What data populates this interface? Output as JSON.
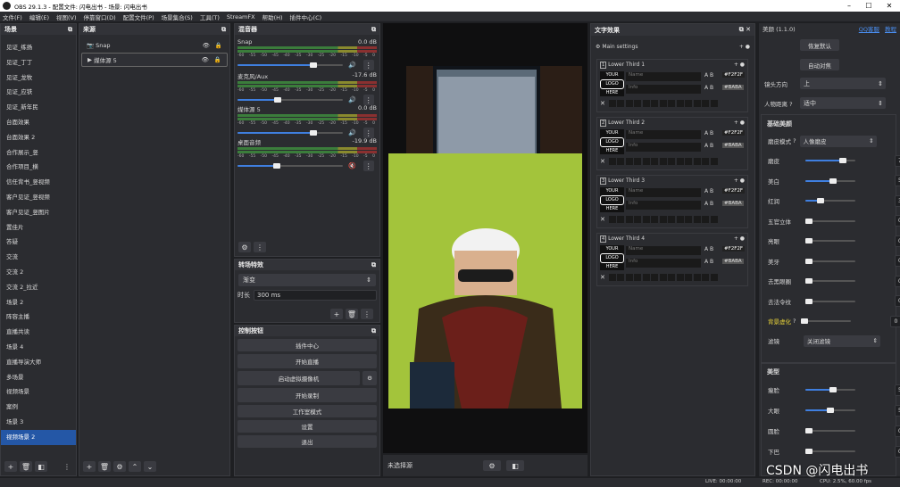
{
  "window": {
    "title": "OBS 29.1.3 - 配置文件: 闪电出书 - 场景: 闪电出书",
    "minimize": "–",
    "maximize": "☐",
    "close": "✕"
  },
  "menu": [
    "文件(F)",
    "编辑(E)",
    "视图(V)",
    "停靠窗口(D)",
    "配置文件(P)",
    "场景集合(S)",
    "工具(T)",
    "StreamFX",
    "帮助(H)",
    "插件中心(C)"
  ],
  "scenes": {
    "title": "场景",
    "items": [
      "见证_练扬",
      "见证_丁丁",
      "见证_龙牧",
      "见证_应铁",
      "见证_新年民",
      "台面效果",
      "台面效果 2",
      "合作展示_竖",
      "合作项目_横",
      "信任背书_竖视频",
      "客户见证_竖视频",
      "客户见证_竖图片",
      "置佳片",
      "答疑",
      "交流",
      "交流 2",
      "交流 2_拉近",
      "场景 2",
      "阵容主播",
      "直播共读",
      "场景 4",
      "直播导演大师",
      "多场景",
      "视频场景",
      "案例",
      "场景 3",
      "视频场景 2"
    ],
    "selected": 26
  },
  "sources": {
    "title": "来源",
    "items": [
      "Snap",
      "媒体源 5"
    ]
  },
  "mixer": {
    "title": "混音器",
    "channels": [
      {
        "name": "Snap",
        "db": "0.0 dB",
        "level": 0.72
      },
      {
        "name": "麦克风/Aux",
        "db": "-17.6 dB",
        "level": 0.38
      },
      {
        "name": "媒体源 5",
        "db": "0.0 dB",
        "level": 0.72
      },
      {
        "name": "桌面音频",
        "db": "-19.9 dB",
        "level": 0.37
      }
    ],
    "ticks": [
      "-60",
      "-55",
      "-50",
      "-45",
      "-40",
      "-35",
      "-30",
      "-25",
      "-20",
      "-15",
      "-10",
      "-5",
      "0"
    ]
  },
  "transitions": {
    "title": "转场特效",
    "type": "渐变",
    "duration_label": "时长",
    "duration": "300 ms"
  },
  "controls": {
    "title": "控制按钮",
    "buttons": [
      "插件中心",
      "开始直播",
      "启动虚拟摄像机",
      "开始录制",
      "工作室模式",
      "设置",
      "退出"
    ]
  },
  "preview": {
    "no_source": "未选择源"
  },
  "text_effects": {
    "title": "文字效果",
    "main": "Main settings",
    "thirds": [
      {
        "title": "Lower Third 1",
        "name": "Name",
        "info": "Info",
        "color1": "#F2F2F",
        "color2": "#BABA"
      },
      {
        "title": "Lower Third 2",
        "name": "Name",
        "info": "Info",
        "color1": "#F2F2F",
        "color2": "#BABA"
      },
      {
        "title": "Lower Third 3",
        "name": "Name",
        "info": "Info",
        "color1": "#F2F2F",
        "color2": "#BABA"
      },
      {
        "title": "Lower Third 4",
        "name": "Name",
        "info": "Info",
        "color1": "#F2F2F",
        "color2": "#BABA"
      }
    ],
    "logo": [
      "YOUR",
      "LOGO",
      "HERE"
    ]
  },
  "beauty": {
    "title": "美颜 (1.1.0)",
    "links": [
      "QQ客服",
      "教程"
    ],
    "reset": "恢复默认",
    "auto": "自动对焦",
    "lens_dir_label": "镜头方向",
    "lens_dir": "上",
    "distance_label": "人物距离",
    "distance": "适中",
    "basic_title": "基础美颜",
    "grind_label": "磨皮模式",
    "grind": "人像磨皮",
    "rows": [
      {
        "label": "磨皮",
        "value": "75"
      },
      {
        "label": "美白",
        "value": "55"
      },
      {
        "label": "红润",
        "value": "30"
      },
      {
        "label": "五官立体",
        "value": "0"
      },
      {
        "label": "亮眼",
        "value": "0"
      },
      {
        "label": "美牙",
        "value": "0"
      },
      {
        "label": "去黑眼圈",
        "value": "0"
      },
      {
        "label": "去法令纹",
        "value": "0"
      },
      {
        "label": "背景虚化",
        "value": "0"
      }
    ],
    "filter_label": "滤镜",
    "filter": "关闭滤镜",
    "shape_title": "美型",
    "shape_rows": [
      {
        "label": "瘦脸",
        "value": "55"
      },
      {
        "label": "大眼",
        "value": "50"
      },
      {
        "label": "圆脸",
        "value": "0"
      },
      {
        "label": "下巴",
        "value": "0"
      }
    ]
  },
  "status": {
    "live": "LIVE: 00:00:00",
    "rec": "REC: 00:00:00",
    "cpu": "CPU: 2.5%, 60.00 fps"
  },
  "watermark": "CSDN @闪电出书"
}
